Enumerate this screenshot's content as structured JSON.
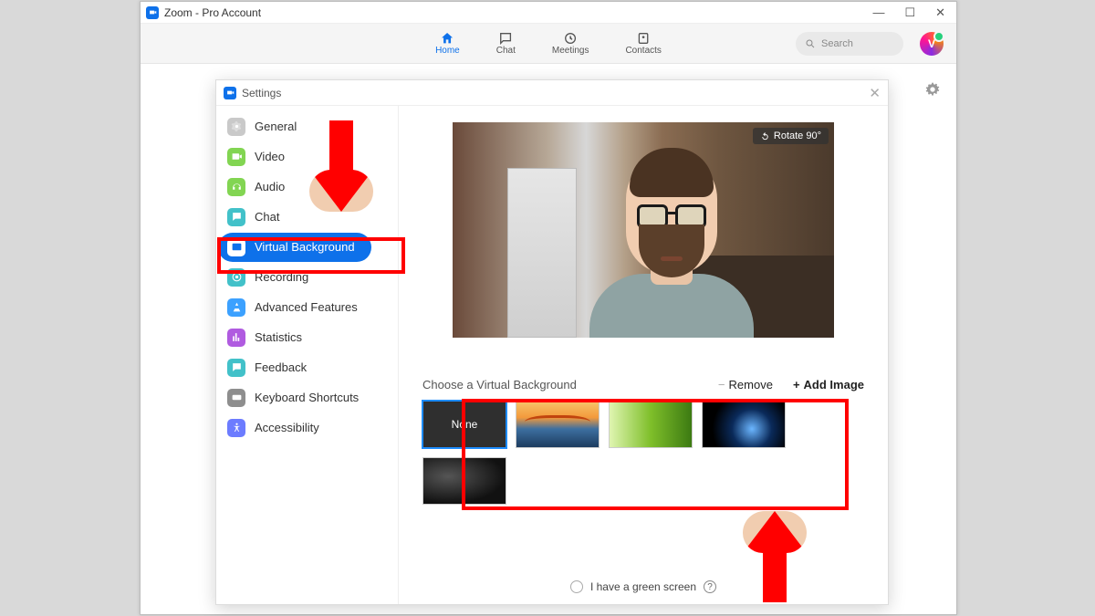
{
  "window": {
    "title": "Zoom - Pro Account"
  },
  "nav": {
    "items": [
      {
        "label": "Home",
        "active": true
      },
      {
        "label": "Chat"
      },
      {
        "label": "Meetings"
      },
      {
        "label": "Contacts"
      }
    ]
  },
  "search": {
    "placeholder": "Search"
  },
  "settings": {
    "title": "Settings",
    "items": [
      {
        "label": "General",
        "color": "#c9c9c9"
      },
      {
        "label": "Video",
        "color": "#82d552"
      },
      {
        "label": "Audio",
        "color": "#82d552"
      },
      {
        "label": "Chat",
        "color": "#42c1c9"
      },
      {
        "label": "Virtual Background",
        "color": "#0e71ea",
        "active": true
      },
      {
        "label": "Recording",
        "color": "#42c1c9"
      },
      {
        "label": "Advanced Features",
        "color": "#3ca1ff"
      },
      {
        "label": "Statistics",
        "color": "#b05be0"
      },
      {
        "label": "Feedback",
        "color": "#42c1c9"
      },
      {
        "label": "Keyboard Shortcuts",
        "color": "#8e8e8e"
      },
      {
        "label": "Accessibility",
        "color": "#6c7cff"
      }
    ]
  },
  "vb": {
    "rotate": "Rotate 90°",
    "choose": "Choose a Virtual Background",
    "remove": "Remove",
    "add": "Add Image",
    "none": "None",
    "greenscreen": "I have a green screen"
  }
}
